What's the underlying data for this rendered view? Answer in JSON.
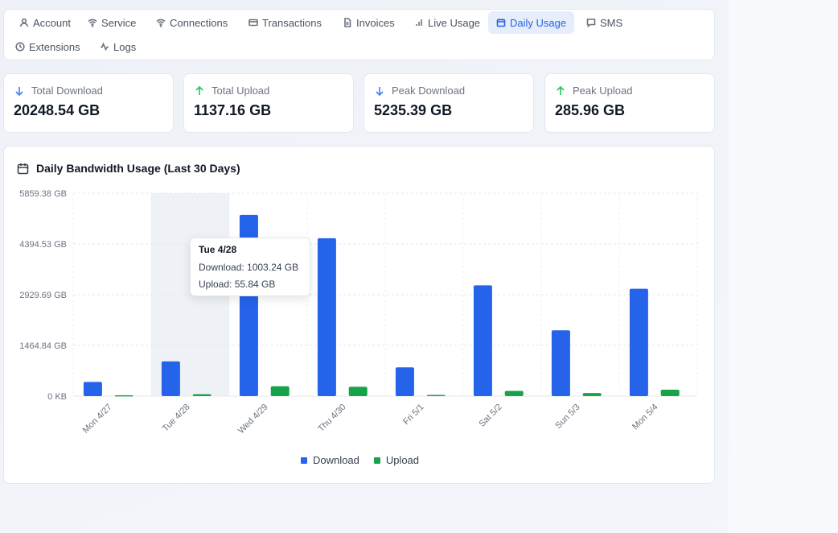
{
  "tabs": [
    {
      "label": "Account",
      "icon": "user-icon",
      "active": false
    },
    {
      "label": "Service",
      "icon": "wifi-icon",
      "active": false
    },
    {
      "label": "Connections",
      "icon": "wifi-icon",
      "active": false
    },
    {
      "label": "Transactions",
      "icon": "credit-card-icon",
      "active": false
    },
    {
      "label": "Invoices",
      "icon": "document-icon",
      "active": false
    },
    {
      "label": "Live Usage",
      "icon": "bar-signal-icon",
      "active": false
    },
    {
      "label": "Daily Usage",
      "icon": "calendar-icon",
      "active": true
    },
    {
      "label": "SMS",
      "icon": "message-icon",
      "active": false
    },
    {
      "label": "Extensions",
      "icon": "clock-icon",
      "active": false
    },
    {
      "label": "Logs",
      "icon": "activity-icon",
      "active": false
    }
  ],
  "stats": [
    {
      "label": "Total Download",
      "value": "20248.54 GB",
      "icon": "arrow-down-icon"
    },
    {
      "label": "Total Upload",
      "value": "1137.16 GB",
      "icon": "arrow-up-icon"
    },
    {
      "label": "Peak Download",
      "value": "5235.39 GB",
      "icon": "arrow-down-icon"
    },
    {
      "label": "Peak Upload",
      "value": "285.96 GB",
      "icon": "arrow-up-icon"
    }
  ],
  "colors": {
    "download": "#2563eb",
    "upload": "#16a34a",
    "accent": "#2563eb",
    "arrow_down": "#3b82f6",
    "arrow_up": "#22c55e"
  },
  "chart": {
    "title": "Daily Bandwidth Usage (Last 30 Days)",
    "tooltip": {
      "title": "Tue 4/28",
      "download": "Download: 1003.24 GB",
      "upload": "Upload: 55.84 GB"
    },
    "legend": {
      "download": "Download",
      "upload": "Upload"
    }
  },
  "chart_data": {
    "type": "bar",
    "categories": [
      "Mon 4/27",
      "Tue 4/28",
      "Wed 4/29",
      "Thu 4/30",
      "Fri 5/1",
      "Sat 5/2",
      "Sun 5/3",
      "Mon 5/4"
    ],
    "series": [
      {
        "name": "Download",
        "values": [
          410,
          1003.24,
          5235.39,
          4560,
          830,
          3200,
          1900,
          3100
        ]
      },
      {
        "name": "Upload",
        "values": [
          25,
          55.84,
          285.96,
          270,
          35,
          150,
          90,
          185
        ]
      }
    ],
    "ylim": [
      0,
      5859.38
    ],
    "yticks": [
      0,
      1464.84,
      2929.69,
      4394.53,
      5859.38
    ],
    "ytick_labels": [
      "0 KB",
      "1464.84 GB",
      "2929.69 GB",
      "4394.53 GB",
      "5859.38 GB"
    ],
    "highlighted_category": "Tue 4/28",
    "grid": true,
    "legend": "bottom-center"
  }
}
